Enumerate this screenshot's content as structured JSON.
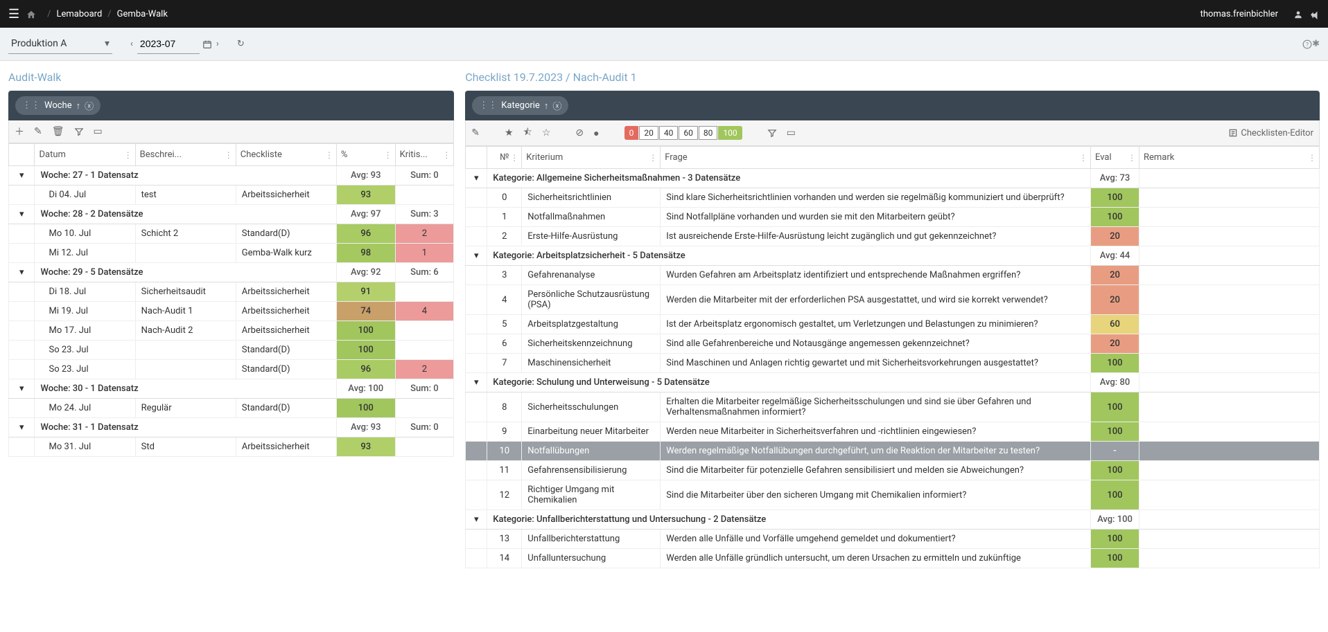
{
  "header": {
    "breadcrumb1": "Lemaboard",
    "breadcrumb2": "Gemba-Walk",
    "user": "thomas.freinbichler"
  },
  "filter": {
    "area": "Produktion A",
    "period": "2023-07"
  },
  "left": {
    "title": "Audit-Walk",
    "group_chip": "Woche",
    "columns": {
      "datum": "Datum",
      "beschrei": "Beschrei...",
      "checkliste": "Checkliste",
      "pct": "%",
      "kritis": "Kritis..."
    },
    "groups": [
      {
        "label": "Woche: 27 - 1 Datensatz",
        "avg": "Avg: 93",
        "sum": "Sum: 0",
        "rows": [
          {
            "datum": "Di 04. Jul",
            "besch": "test",
            "check": "Arbeitssicherheit",
            "pct": 93,
            "krit": ""
          }
        ]
      },
      {
        "label": "Woche: 28 - 2 Datensätze",
        "avg": "Avg: 97",
        "sum": "Sum: 3",
        "rows": [
          {
            "datum": "Mo 10. Jul",
            "besch": "Schicht 2",
            "check": "Standard(D)",
            "pct": 96,
            "krit": 2,
            "kbad": true
          },
          {
            "datum": "Mi 12. Jul",
            "besch": "",
            "check": "Gemba-Walk kurz",
            "pct": 98,
            "krit": 1,
            "kbad": true
          }
        ]
      },
      {
        "label": "Woche: 29 - 5 Datensätze",
        "avg": "Avg: 92",
        "sum": "Sum: 6",
        "rows": [
          {
            "datum": "Di 18. Jul",
            "besch": "Sicherheitsaudit",
            "check": "Arbeitssicherheit",
            "pct": 91,
            "krit": ""
          },
          {
            "datum": "Mi 19. Jul",
            "besch": "Nach-Audit 1",
            "check": "Arbeitssicherheit",
            "pct": 74,
            "krit": 4,
            "kbad": true
          },
          {
            "datum": "Mo 17. Jul",
            "besch": "Nach-Audit 2",
            "check": "Arbeitssicherheit",
            "pct": 100,
            "krit": ""
          },
          {
            "datum": "So 23. Jul",
            "besch": "",
            "check": "Standard(D)",
            "pct": 100,
            "krit": ""
          },
          {
            "datum": "So 23. Jul",
            "besch": "",
            "check": "Standard(D)",
            "pct": 96,
            "krit": 2,
            "kbad": true
          }
        ]
      },
      {
        "label": "Woche: 30 - 1 Datensatz",
        "avg": "Avg: 100",
        "sum": "Sum: 0",
        "rows": [
          {
            "datum": "Mo 24. Jul",
            "besch": "Regulär",
            "check": "Standard(D)",
            "pct": 100,
            "krit": ""
          }
        ]
      },
      {
        "label": "Woche: 31 - 1 Datensatz",
        "avg": "Avg: 93",
        "sum": "Sum: 0",
        "rows": [
          {
            "datum": "Mo 31. Jul",
            "besch": "Std",
            "check": "Arbeitssicherheit",
            "pct": 93,
            "krit": ""
          }
        ]
      }
    ]
  },
  "right": {
    "title": "Checklist 19.7.2023 / Nach-Audit 1",
    "group_chip": "Kategorie",
    "editor_link": "Checklisten-Editor",
    "pills": [
      "0",
      "20",
      "40",
      "60",
      "80",
      "100"
    ],
    "columns": {
      "no": "№",
      "kriterium": "Kriterium",
      "frage": "Frage",
      "eval": "Eval",
      "remark": "Remark"
    },
    "groups": [
      {
        "label": "Kategorie: Allgemeine Sicherheitsmaßnahmen - 3 Datensätze",
        "avg": "Avg: 73",
        "rows": [
          {
            "no": 0,
            "krit": "Sicherheitsrichtlinien",
            "frage": "Sind klare Sicherheitsrichtlinien vorhanden und werden sie regelmäßig kommuniziert und überprüft?",
            "eval": 100
          },
          {
            "no": 1,
            "krit": "Notfallmaßnahmen",
            "frage": "Sind Notfallpläne vorhanden und wurden sie mit den Mitarbeitern geübt?",
            "eval": 100
          },
          {
            "no": 2,
            "krit": "Erste-Hilfe-Ausrüstung",
            "frage": "Ist ausreichende Erste-Hilfe-Ausrüstung leicht zugänglich und gut gekennzeichnet?",
            "eval": 20
          }
        ]
      },
      {
        "label": "Kategorie: Arbeitsplatzsicherheit - 5 Datensätze",
        "avg": "Avg: 44",
        "rows": [
          {
            "no": 3,
            "krit": "Gefahrenanalyse",
            "frage": "Wurden Gefahren am Arbeitsplatz identifiziert und entsprechende Maßnahmen ergriffen?",
            "eval": 20
          },
          {
            "no": 4,
            "krit": "Persönliche Schutzausrüstung (PSA)",
            "frage": "Werden die Mitarbeiter mit der erforderlichen PSA ausgestattet, und wird sie korrekt verwendet?",
            "eval": 20
          },
          {
            "no": 5,
            "krit": "Arbeitsplatzgestaltung",
            "frage": "Ist der Arbeitsplatz ergonomisch gestaltet, um Verletzungen und Belastungen zu minimieren?",
            "eval": 60
          },
          {
            "no": 6,
            "krit": "Sicherheitskennzeichnung",
            "frage": "Sind alle Gefahrenbereiche und Notausgänge angemessen gekennzeichnet?",
            "eval": 20
          },
          {
            "no": 7,
            "krit": "Maschinensicherheit",
            "frage": "Sind Maschinen und Anlagen richtig gewartet und mit Sicherheitsvorkehrungen ausgestattet?",
            "eval": 100
          }
        ]
      },
      {
        "label": "Kategorie: Schulung und Unterweisung - 5 Datensätze",
        "avg": "Avg: 80",
        "rows": [
          {
            "no": 8,
            "krit": "Sicherheitsschulungen",
            "frage": "Erhalten die Mitarbeiter regelmäßige Sicherheitsschulungen und sind sie über Gefahren und Verhaltensmaßnahmen informiert?",
            "eval": 100
          },
          {
            "no": 9,
            "krit": "Einarbeitung neuer Mitarbeiter",
            "frage": "Werden neue Mitarbeiter in Sicherheitsverfahren und -richtlinien eingewiesen?",
            "eval": 100
          },
          {
            "no": 10,
            "krit": "Notfallübungen",
            "frage": "Werden regelmäßige Notfallübungen durchgeführt, um die Reaktion der Mitarbeiter zu testen?",
            "eval": "-",
            "selected": true
          },
          {
            "no": 11,
            "krit": "Gefahrensensibilisierung",
            "frage": "Sind die Mitarbeiter für potenzielle Gefahren sensibilisiert und melden sie Abweichungen?",
            "eval": 100
          },
          {
            "no": 12,
            "krit": "Richtiger Umgang mit Chemikalien",
            "frage": "Sind die Mitarbeiter über den sicheren Umgang mit Chemikalien informiert?",
            "eval": 100
          }
        ]
      },
      {
        "label": "Kategorie: Unfallberichterstattung und Untersuchung - 2 Datensätze",
        "avg": "Avg: 100",
        "rows": [
          {
            "no": 13,
            "krit": "Unfallberichterstattung",
            "frage": "Werden alle Unfälle und Vorfälle umgehend gemeldet und dokumentiert?",
            "eval": 100
          },
          {
            "no": 14,
            "krit": "Unfalluntersuchung",
            "frage": "Werden alle Unfälle gründlich untersucht, um deren Ursachen zu ermitteln und zukünftige",
            "eval": 100
          }
        ]
      }
    ]
  }
}
